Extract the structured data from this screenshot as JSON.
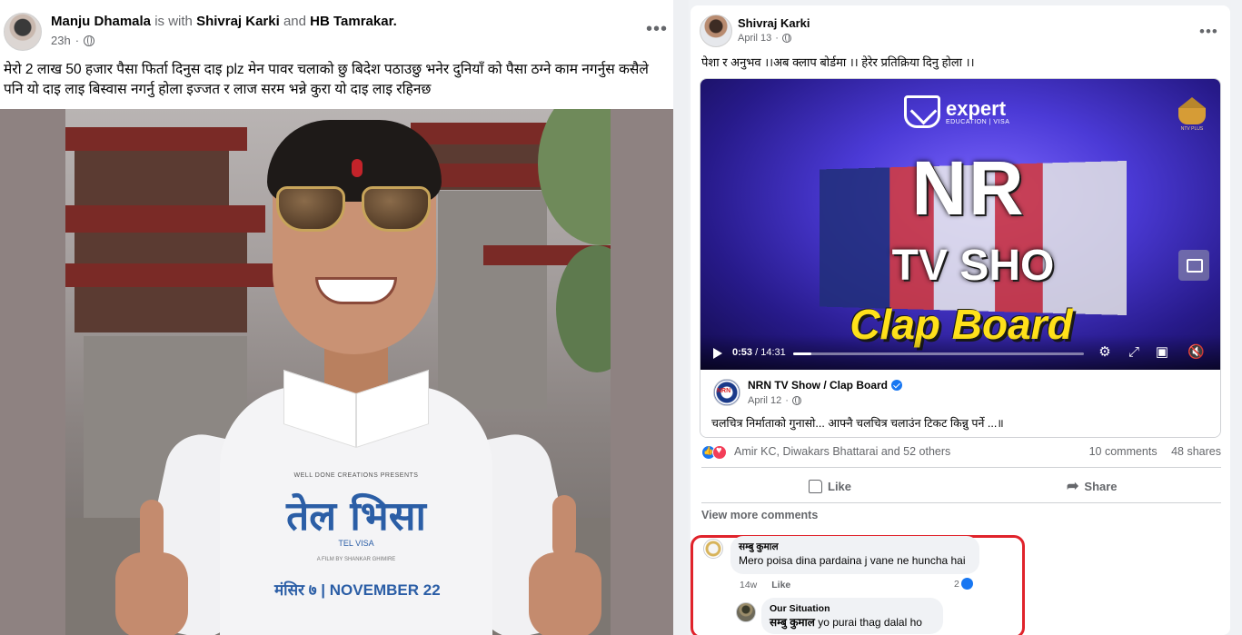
{
  "left_post": {
    "author": "Manju Dhamala",
    "is_with_text": "is with",
    "tagged_1": "Shivraj Karki",
    "and_text": "and",
    "tagged_2": "HB Tamrakar.",
    "time": "23h",
    "text": "मेरो  2 लाख 50 हजार पैसा फिर्ता दिनुस दाइ plz  मेन पावर चलाको छु बिदेश पठाउछु भनेर दुनियाँ को पैसा ठग्ने काम नगर्नुस कसैले पनि यो दाइ लाइ बिस्वास नगर्नु होला इज्जत र लाज सरम भन्ने कुरा यो दाइ लाइ रहिनछ",
    "photo": {
      "tshirt_presents": "WELL DONE CREATIONS PRESENTS",
      "tshirt_title": "तेल भिसा",
      "tshirt_subtitle": "TEL VISA",
      "tshirt_credit": "A FILM BY SHANKAR GHIMIRE",
      "tshirt_date": "मंसिर ७ | NOVEMBER 22"
    }
  },
  "right_post": {
    "author": "Shivraj Karki",
    "time": "April 13",
    "text": "पेशा र अनुभव ।।अब  क्लाप बोर्डमा ।। हेरेर प्रतिक्रिया दिनु होला ।।",
    "video": {
      "logo_name": "expert",
      "logo_sub": "EDUCATION | VISA",
      "badge_text": "NTV PLUS",
      "title_line_1": "NR",
      "title_line_2": "TV SHO",
      "title_line_3": "Clap Board",
      "current_time": "0:53",
      "duration": "14:31",
      "progress": 0.061
    },
    "source": {
      "name": "NRN TV Show / Clap Board",
      "logo_text": "NRN",
      "time": "April 12",
      "text": "चलचित्र निर्माताको गुनासो... आफ्नै चलचित्र चलाउंन टिकट किन्नु पर्ने ...॥"
    },
    "reactions": {
      "names": "Amir KC, Diwakars Bhattarai and 52 others",
      "comments": "10 comments",
      "shares": "48 shares"
    },
    "actions": {
      "like": "Like",
      "share": "Share"
    },
    "view_more": "View more comments",
    "comments": [
      {
        "author": "सम्बु कुमाल",
        "text": "Mero poisa dina pardaina j vane ne huncha hai",
        "time": "14w",
        "like": "Like",
        "reaction_count": "2"
      },
      {
        "author": "Our Situation",
        "mention": "सम्बु कुमाल",
        "text": "yo purai thag dalal ho"
      }
    ]
  },
  "colors": {
    "facebook_blue": "#1877f2",
    "highlight_red": "#e0232b",
    "clap_yellow": "#ffe11a"
  }
}
